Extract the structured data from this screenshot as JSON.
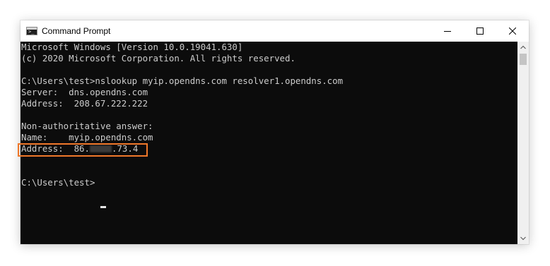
{
  "window": {
    "title": "Command Prompt",
    "app_icon": "cmd-icon"
  },
  "titlebar_buttons": {
    "minimize_icon": "minimize-icon",
    "maximize_icon": "maximize-icon",
    "close_icon": "close-icon"
  },
  "console": {
    "line_1": "Microsoft Windows [Version 10.0.19041.630]",
    "line_2": "(c) 2020 Microsoft Corporation. All rights reserved.",
    "line_3": "C:\\Users\\test>nslookup myip.opendns.com resolver1.opendns.com",
    "line_4": "Server:  dns.opendns.com",
    "line_5": "Address:  208.67.222.222",
    "line_6": "Non-authoritative answer:",
    "line_7": "Name:    myip.opendns.com",
    "address_prefix": "Address:  86.",
    "address_suffix": ".73.4",
    "prompt": "C:\\Users\\test>"
  },
  "colors": {
    "console_bg": "#0c0c0c",
    "console_text": "#cccccc",
    "highlight": "#f0782a"
  }
}
